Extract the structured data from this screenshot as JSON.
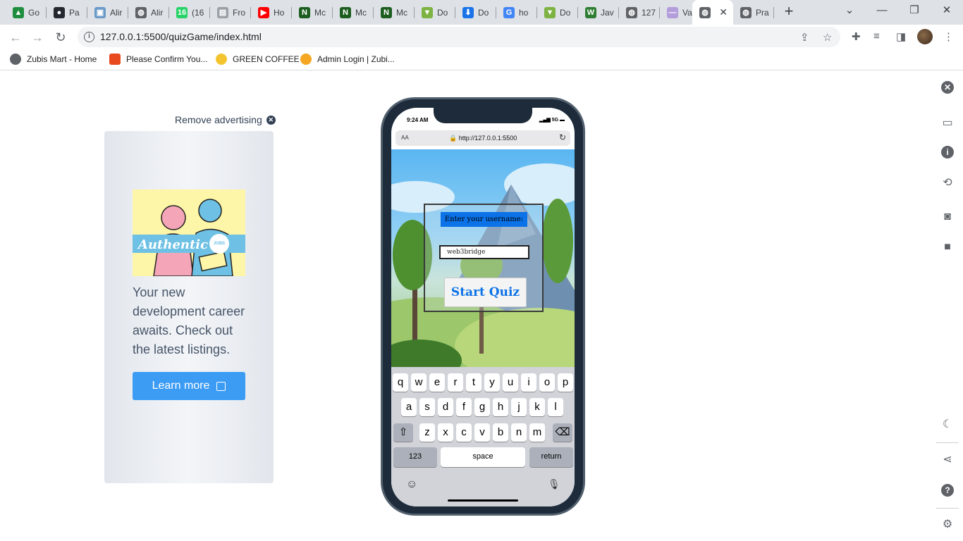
{
  "browser": {
    "tabs": [
      {
        "label": "Go",
        "icon": "google-drive-icon",
        "color": "#1e8e3e"
      },
      {
        "label": "Pa",
        "icon": "github-icon",
        "color": "#24292f"
      },
      {
        "label": "Alir",
        "icon": "image-icon",
        "color": "#6a9ac8"
      },
      {
        "label": "Alir",
        "icon": "globe-icon",
        "color": "#5f6368"
      },
      {
        "label": "(16",
        "icon": "whatsapp-icon",
        "color": "#25d366"
      },
      {
        "label": "Fro",
        "icon": "page-icon",
        "color": "#9aa0a6"
      },
      {
        "label": "Ho",
        "icon": "youtube-icon",
        "color": "#ff0000"
      },
      {
        "label": "Mc",
        "icon": "n-logo-icon",
        "color": "#1d5e20"
      },
      {
        "label": "Mc",
        "icon": "n-logo-icon",
        "color": "#1d5e20"
      },
      {
        "label": "Mc",
        "icon": "n-logo-icon",
        "color": "#1d5e20"
      },
      {
        "label": "Do",
        "icon": "download-green-icon",
        "color": "#7cb342"
      },
      {
        "label": "Do",
        "icon": "download-blue-icon",
        "color": "#1a73e8"
      },
      {
        "label": "ho",
        "icon": "google-icon",
        "color": "#4285f4"
      },
      {
        "label": "Do",
        "icon": "download-green-icon",
        "color": "#7cb342"
      },
      {
        "label": "Jav",
        "icon": "w-logo-icon",
        "color": "#2e7d32"
      },
      {
        "label": "127",
        "icon": "globe-icon",
        "color": "#5f6368"
      },
      {
        "label": "Var",
        "icon": "dash-icon",
        "color": "#b39ddb"
      },
      {
        "label": "",
        "icon": "globe-icon",
        "color": "#5f6368",
        "active": true
      },
      {
        "label": "Pra",
        "icon": "globe-icon",
        "color": "#5f6368"
      }
    ],
    "new_tab_label": "+",
    "url": "127.0.0.1:5500/quizGame/index.html",
    "bookmarks": [
      {
        "label": "Zubis Mart - Home",
        "color": "#5f6368"
      },
      {
        "label": "Please Confirm You...",
        "color": "#e8491d"
      },
      {
        "label": "GREEN COFFEE",
        "color": "#f4c430"
      },
      {
        "label": "Admin Login | Zubi...",
        "color": "#f5a623"
      }
    ]
  },
  "ad": {
    "remove_label": "Remove advertising",
    "image_word": "Authentic",
    "image_badge": "JOBS",
    "text": "Your new development career awaits. Check out the latest listings.",
    "button_label": "Learn more",
    "button_color": "#3c9cf4"
  },
  "phone": {
    "time": "9:24 AM",
    "network": "5G",
    "text_size_label": "AA",
    "url": "http://127.0.0.1:5500",
    "quiz": {
      "label": "Enter your username:",
      "username": "web3bridge",
      "start_label": "Start Quiz",
      "accent": "#0b72e7"
    },
    "keyboard": {
      "row1": [
        "q",
        "w",
        "e",
        "r",
        "t",
        "y",
        "u",
        "i",
        "o",
        "p"
      ],
      "row2": [
        "a",
        "s",
        "d",
        "f",
        "g",
        "h",
        "j",
        "k",
        "l"
      ],
      "row3": [
        "z",
        "x",
        "c",
        "v",
        "b",
        "n",
        "m"
      ],
      "shift": "⇧",
      "backspace": "⌫",
      "numbers": "123",
      "space": "space",
      "return": "return",
      "emoji": "☺",
      "mic": "🎙"
    }
  },
  "sidebar": {
    "icons": [
      "close-icon",
      "devices-icon",
      "info-icon",
      "rotate-icon",
      "camera-icon",
      "video-icon",
      "moon-icon",
      "share-icon",
      "help-icon",
      "settings-icon"
    ]
  }
}
